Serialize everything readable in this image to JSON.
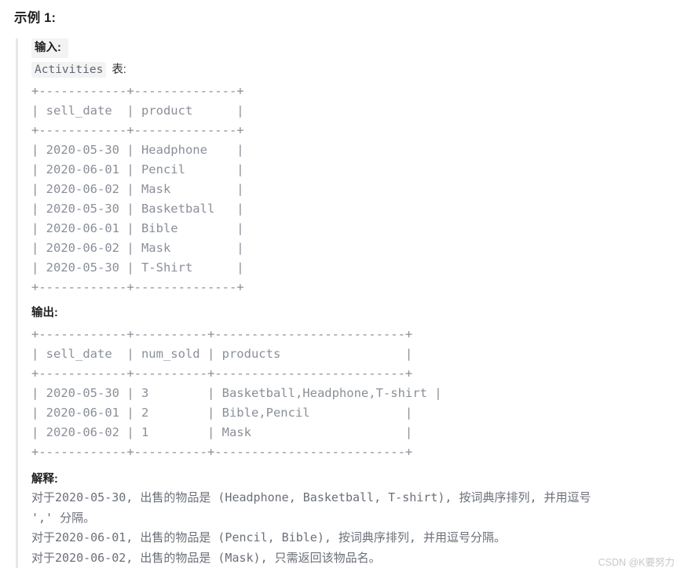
{
  "page": {
    "title": "示例 1:",
    "watermark": "CSDN @K要努力"
  },
  "input_section": {
    "label": "输入:",
    "table_name": "Activities",
    "table_suffix": "表:",
    "ascii_table": "+------------+--------------+\n| sell_date  | product      |\n+------------+--------------+\n| 2020-05-30 | Headphone    |\n| 2020-06-01 | Pencil       |\n| 2020-06-02 | Mask         |\n| 2020-05-30 | Basketball   |\n| 2020-06-01 | Bible        |\n| 2020-06-02 | Mask         |\n| 2020-05-30 | T-Shirt      |\n+------------+--------------+",
    "columns": [
      "sell_date",
      "product"
    ],
    "rows": [
      [
        "2020-05-30",
        "Headphone"
      ],
      [
        "2020-06-01",
        "Pencil"
      ],
      [
        "2020-06-02",
        "Mask"
      ],
      [
        "2020-05-30",
        "Basketball"
      ],
      [
        "2020-06-01",
        "Bible"
      ],
      [
        "2020-06-02",
        "Mask"
      ],
      [
        "2020-05-30",
        "T-Shirt"
      ]
    ]
  },
  "output_section": {
    "label": "输出:",
    "ascii_table": "+------------+----------+--------------------------+\n| sell_date  | num_sold | products                 |\n+------------+----------+--------------------------+\n| 2020-05-30 | 3        | Basketball,Headphone,T-shirt |\n| 2020-06-01 | 2        | Bible,Pencil             |\n| 2020-06-02 | 1        | Mask                     |\n+------------+----------+--------------------------+",
    "columns": [
      "sell_date",
      "num_sold",
      "products"
    ],
    "rows": [
      [
        "2020-05-30",
        "3",
        "Basketball,Headphone,T-shirt"
      ],
      [
        "2020-06-01",
        "2",
        "Bible,Pencil"
      ],
      [
        "2020-06-02",
        "1",
        "Mask"
      ]
    ]
  },
  "explanation": {
    "label": "解释:",
    "body": "对于2020-05-30, 出售的物品是 (Headphone, Basketball, T-shirt), 按词典序排列, 并用逗号\n',' 分隔。\n对于2020-06-01, 出售的物品是 (Pencil, Bible), 按词典序排列, 并用逗号分隔。\n对于2020-06-02, 出售的物品是 (Mask), 只需返回该物品名。"
  }
}
